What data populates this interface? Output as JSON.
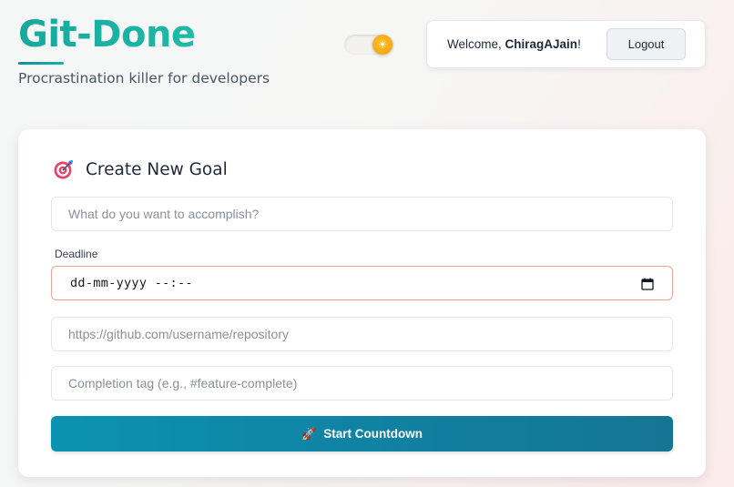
{
  "header": {
    "brand_title": "Git-Done",
    "tagline": "Procrastination killer for developers",
    "theme_toggle_icon": "sun-icon",
    "welcome_prefix": "Welcome, ",
    "username": "ChiragAJain",
    "welcome_suffix": "!",
    "logout_label": "Logout"
  },
  "goal_form": {
    "title": "Create New Goal",
    "title_icon": "target-icon",
    "goal_placeholder": "What do you want to accomplish?",
    "deadline_label": "Deadline",
    "deadline_value": "dd-mm-yyyy --:--",
    "repo_placeholder": "https://github.com/username/repository",
    "tag_placeholder": "Completion tag (e.g., #feature-complete)",
    "submit_label": "Start Countdown",
    "submit_icon": "rocket-icon"
  },
  "colors": {
    "brand_teal": "#1bb7a5",
    "button_teal": "#117fa0",
    "deadline_border": "#f2a19a",
    "toggle_sun": "#f59e0b"
  }
}
